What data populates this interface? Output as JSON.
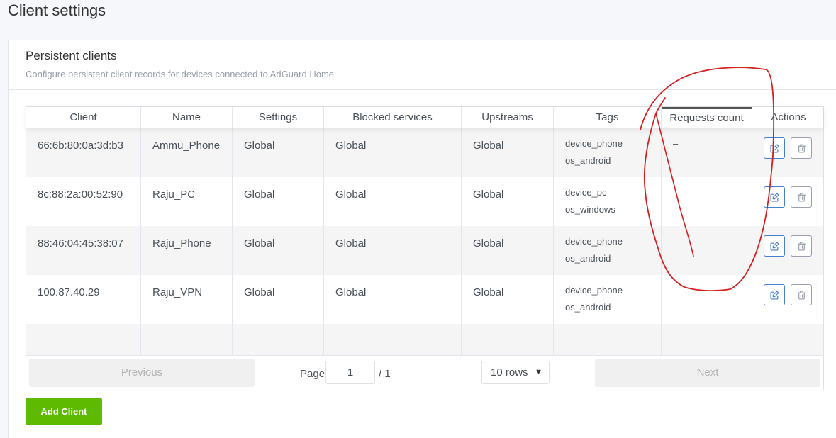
{
  "page": {
    "title": "Client settings"
  },
  "card": {
    "title": "Persistent clients",
    "subtitle": "Configure persistent client records for devices connected to AdGuard Home"
  },
  "table": {
    "columns": [
      "Client",
      "Name",
      "Settings",
      "Blocked services",
      "Upstreams",
      "Tags",
      "Requests count",
      "Actions"
    ],
    "rows": [
      {
        "client": "66:6b:80:0a:3d:b3",
        "name": "Ammu_Phone",
        "settings": "Global",
        "blocked": "Global",
        "upstreams": "Global",
        "tag1": "device_phone",
        "tag2": "os_android",
        "requests": "–"
      },
      {
        "client": "8c:88:2a:00:52:90",
        "name": "Raju_PC",
        "settings": "Global",
        "blocked": "Global",
        "upstreams": "Global",
        "tag1": "device_pc",
        "tag2": "os_windows",
        "requests": "–"
      },
      {
        "client": "88:46:04:45:38:07",
        "name": "Raju_Phone",
        "settings": "Global",
        "blocked": "Global",
        "upstreams": "Global",
        "tag1": "device_phone",
        "tag2": "os_android",
        "requests": "–"
      },
      {
        "client": "100.87.40.29",
        "name": "Raju_VPN",
        "settings": "Global",
        "blocked": "Global",
        "upstreams": "Global",
        "tag1": "device_phone",
        "tag2": "os_android",
        "requests": "–"
      }
    ]
  },
  "pagination": {
    "previous": "Previous",
    "page_label": "Page",
    "page_value": "1",
    "total": "/ 1",
    "rows_select": "10 rows",
    "next": "Next"
  },
  "actions": {
    "add_client": "Add Client"
  },
  "colors": {
    "accent": "#467fcf",
    "success": "#5eba00",
    "annotation": "#d42020"
  },
  "icons": {
    "edit": "edit-icon",
    "delete": "trash-icon"
  }
}
